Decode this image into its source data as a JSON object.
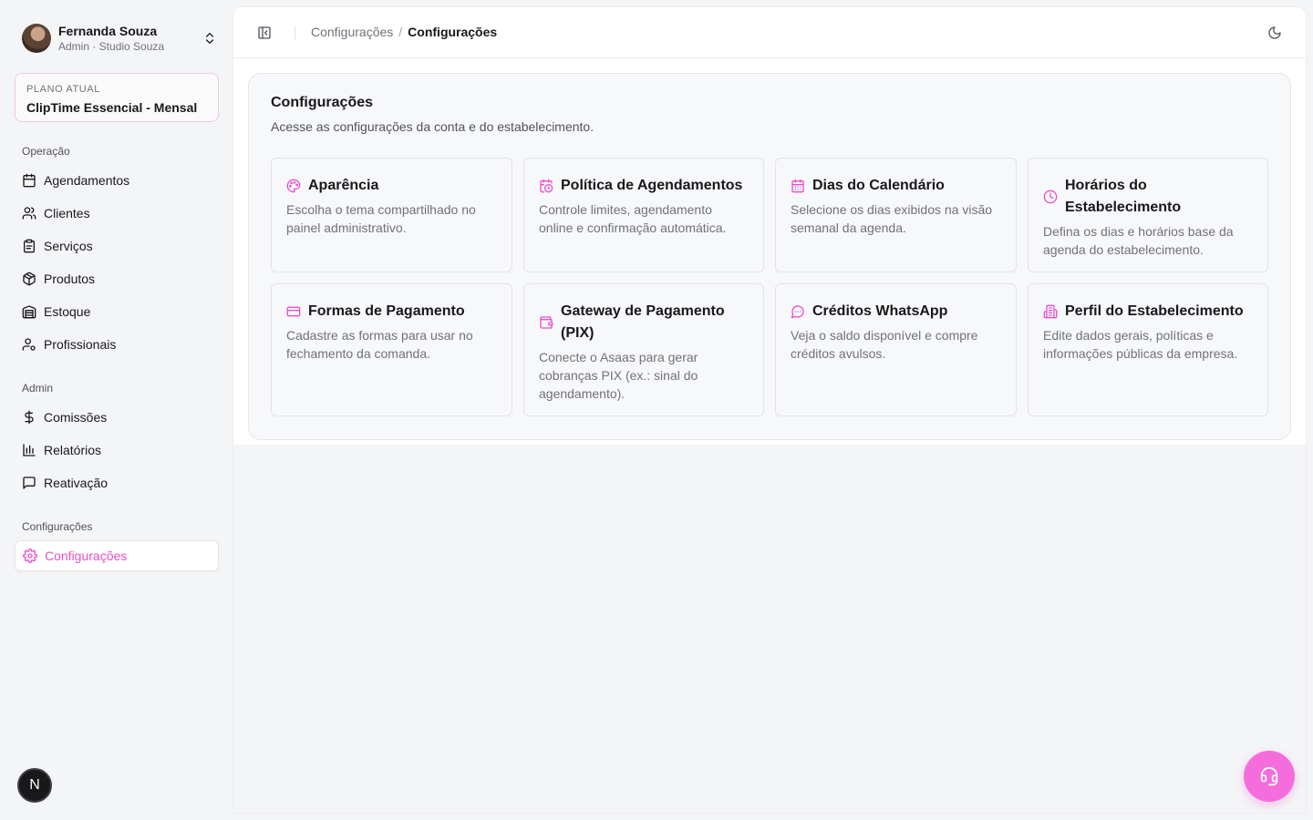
{
  "user": {
    "name": "Fernanda Souza",
    "role": "Admin · Studio Souza"
  },
  "plan": {
    "label": "PLANO ATUAL",
    "name": "ClipTime Essencial - Mensal"
  },
  "sidebar": {
    "sections": [
      {
        "label": "Operação",
        "items": [
          {
            "label": "Agendamentos",
            "icon": "calendar-icon"
          },
          {
            "label": "Clientes",
            "icon": "users-icon"
          },
          {
            "label": "Serviços",
            "icon": "clipboard-icon"
          },
          {
            "label": "Produtos",
            "icon": "package-icon"
          },
          {
            "label": "Estoque",
            "icon": "warehouse-icon"
          },
          {
            "label": "Profissionais",
            "icon": "user-cog-icon"
          }
        ]
      },
      {
        "label": "Admin",
        "items": [
          {
            "label": "Comissões",
            "icon": "dollar-icon"
          },
          {
            "label": "Relatórios",
            "icon": "bar-chart-icon"
          },
          {
            "label": "Reativação",
            "icon": "message-square-icon"
          }
        ]
      },
      {
        "label": "Configurações",
        "items": [
          {
            "label": "Configurações",
            "icon": "gear-icon",
            "active": true
          }
        ]
      }
    ]
  },
  "topbar": {
    "breadcrumb_parent": "Configurações",
    "breadcrumb_separator": "/",
    "breadcrumb_current": "Configurações"
  },
  "panel": {
    "title": "Configurações",
    "subtitle": "Acesse as configurações da conta e do estabelecimento.",
    "cards": [
      {
        "title": "Aparência",
        "desc": "Escolha o tema compartilhado no painel administrativo.",
        "icon": "palette-icon"
      },
      {
        "title": "Política de Agendamentos",
        "desc": "Controle limites, agendamento online e confirmação automática.",
        "icon": "calendar-clock-icon"
      },
      {
        "title": "Dias do Calendário",
        "desc": "Selecione os dias exibidos na visão semanal da agenda.",
        "icon": "calendar-days-icon"
      },
      {
        "title": "Horários do Estabelecimento",
        "desc": "Defina os dias e horários base da agenda do estabelecimento.",
        "icon": "clock-icon"
      },
      {
        "title": "Formas de Pagamento",
        "desc": "Cadastre as formas para usar no fechamento da comanda.",
        "icon": "credit-card-icon"
      },
      {
        "title": "Gateway de Pagamento (PIX)",
        "desc": "Conecte o Asaas para gerar cobranças PIX (ex.: sinal do agendamento).",
        "icon": "wallet-icon"
      },
      {
        "title": "Créditos WhatsApp",
        "desc": "Veja o saldo disponível e compre créditos avulsos.",
        "icon": "message-circle-icon"
      },
      {
        "title": "Perfil do Estabelecimento",
        "desc": "Edite dados gerais, políticas e informações públicas da empresa.",
        "icon": "building-icon"
      }
    ]
  },
  "badge": {
    "letter": "N"
  },
  "colors": {
    "accent": "#ec4fc9",
    "fab": "#f56ddc"
  }
}
